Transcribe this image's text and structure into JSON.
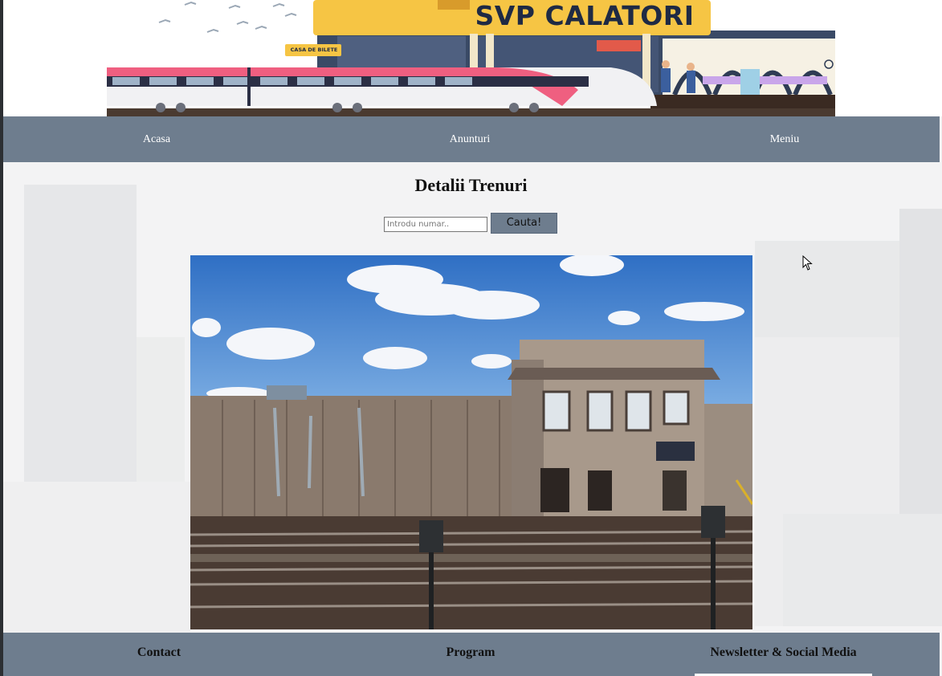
{
  "header": {
    "brand_title": "SVP CALATORI",
    "ticket_sign": "CASA DE BILETE"
  },
  "nav": {
    "items": [
      {
        "label": "Acasa"
      },
      {
        "label": "Anunturi"
      },
      {
        "label": "Meniu"
      }
    ]
  },
  "main": {
    "title": "Detalii Trenuri",
    "search": {
      "placeholder": "Introdu numar..",
      "value": "",
      "button_label": "Cauta!"
    }
  },
  "footer": {
    "headings": [
      "Contact",
      "Program",
      "Newsletter & Social Media"
    ]
  },
  "colors": {
    "nav_bg": "#6e7d8e",
    "page_bg": "#f4f4f5",
    "brand_yellow": "#f6c544"
  }
}
